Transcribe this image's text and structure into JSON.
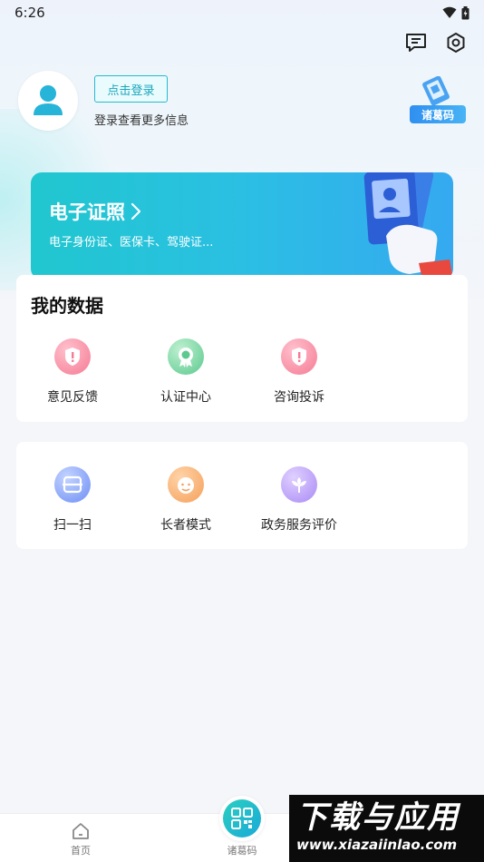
{
  "status_bar": {
    "time": "6:26"
  },
  "profile": {
    "login_button": "点击登录",
    "login_hint": "登录查看更多信息"
  },
  "zhuge_badge": {
    "label": "诸葛码"
  },
  "cert_card": {
    "title": "电子证照",
    "subtitle": "电子身份证、医保卡、驾驶证..."
  },
  "my_data": {
    "title": "我的数据",
    "items": [
      {
        "label": "意见反馈",
        "icon": "shield-feedback-icon"
      },
      {
        "label": "认证中心",
        "icon": "badge-certify-icon"
      },
      {
        "label": "咨询投诉",
        "icon": "shield-complaint-icon"
      }
    ]
  },
  "tools": {
    "items": [
      {
        "label": "扫一扫",
        "icon": "scan-icon"
      },
      {
        "label": "长者模式",
        "icon": "elder-face-icon"
      },
      {
        "label": "政务服务评价",
        "icon": "flower-rating-icon"
      }
    ]
  },
  "tabbar": {
    "home_label": "首页",
    "code_label": "诸葛码"
  },
  "watermark": {
    "main": "下载与应用",
    "url": "www.xiazaiinlao.com"
  },
  "colors": {
    "accent": "#27b9cf",
    "card_gradient_start": "#20c7cf",
    "card_gradient_end": "#35a9f0"
  }
}
